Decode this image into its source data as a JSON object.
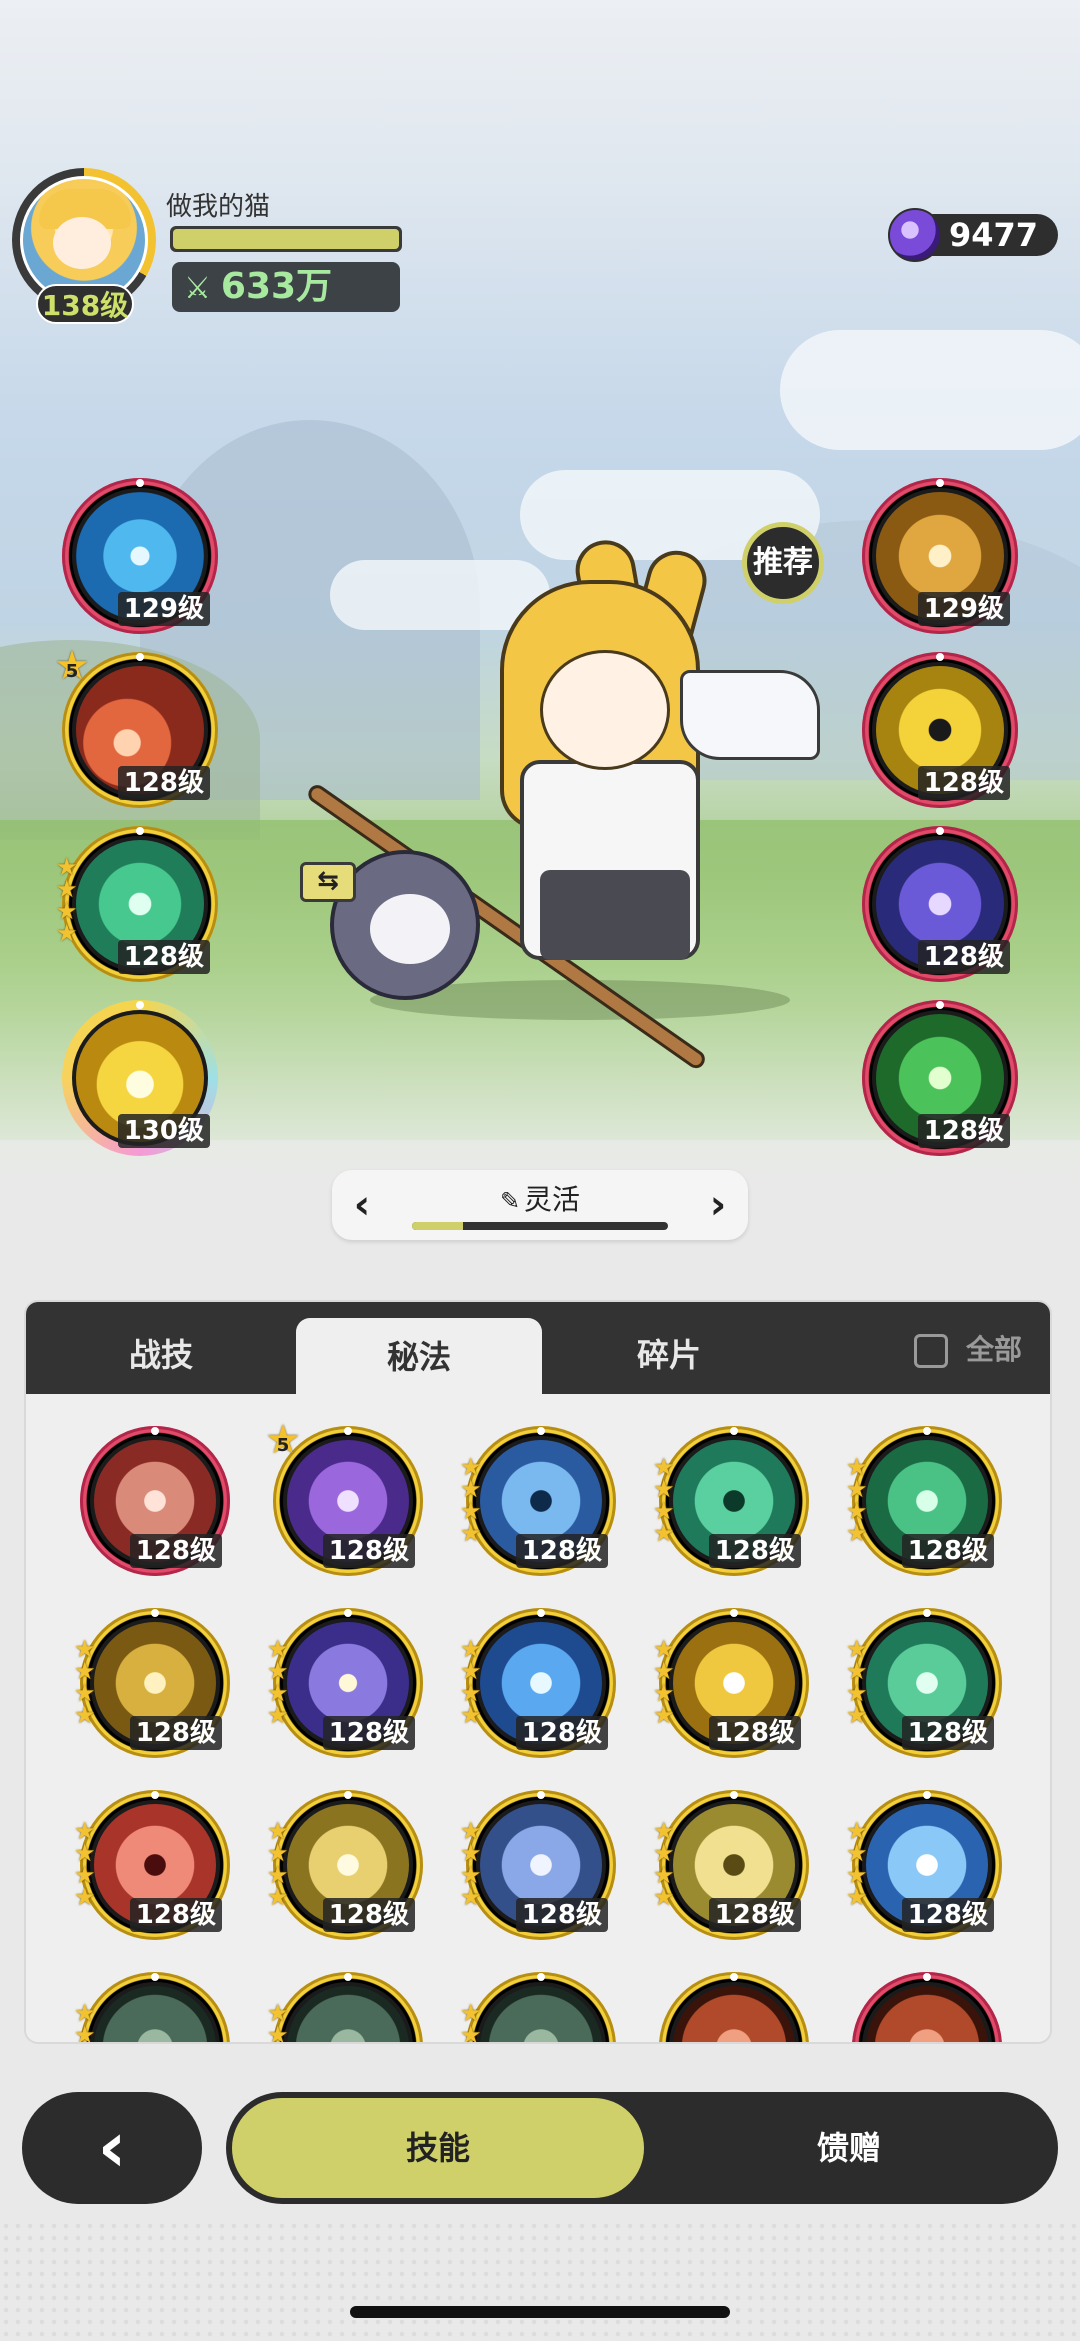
{
  "player": {
    "name": "做我的猫",
    "level": "138级",
    "power": "633万",
    "hp_fill_percent": 100
  },
  "currency": {
    "gems": "9477",
    "icon": "purple-gem-icon"
  },
  "equipped_left": [
    {
      "level": "129级",
      "ring": "red",
      "art": "swirl-blue",
      "stars": 0
    },
    {
      "level": "128级",
      "ring": "gold",
      "art": "fire",
      "stars": 5,
      "star_label": "5"
    },
    {
      "level": "128级",
      "ring": "gold",
      "art": "wind-green",
      "stars": 4
    },
    {
      "level": "130级",
      "ring": "rainbow",
      "art": "lightning",
      "stars": 0
    }
  ],
  "equipped_right": [
    {
      "level": "129级",
      "ring": "red",
      "art": "gold-slash"
    },
    {
      "level": "128级",
      "ring": "red",
      "art": "yellow-figure"
    },
    {
      "level": "128级",
      "ring": "red",
      "art": "purple-clock"
    },
    {
      "level": "128级",
      "ring": "red",
      "art": "green-blades"
    }
  ],
  "recommend_label": "推荐",
  "swap_icon": "swap-icon",
  "build": {
    "name": "灵活",
    "progress_percent": 20,
    "prev": "‹",
    "next": "›"
  },
  "tabs": {
    "t1": "战技",
    "t2": "秘法",
    "t3": "碎片",
    "all": "全部",
    "active": "秘法"
  },
  "grid": [
    {
      "level": "128级",
      "ring": "red",
      "art": "red-feather",
      "stars": 0
    },
    {
      "level": "128级",
      "ring": "gold",
      "art": "purple-rune",
      "stars": 5,
      "star_label": "5"
    },
    {
      "level": "128级",
      "ring": "gold",
      "art": "blue-figure",
      "stars": 4
    },
    {
      "level": "128级",
      "ring": "gold",
      "art": "teal-figure",
      "stars": 4
    },
    {
      "level": "128级",
      "ring": "gold",
      "art": "green-heart",
      "stars": 4
    },
    {
      "level": "128级",
      "ring": "gold",
      "art": "gold-hand",
      "stars": 4
    },
    {
      "level": "128级",
      "ring": "gold",
      "art": "purple-sparkle",
      "stars": 4
    },
    {
      "level": "128级",
      "ring": "gold",
      "art": "crystal",
      "stars": 4
    },
    {
      "level": "128级",
      "ring": "gold",
      "art": "gold-burst",
      "stars": 4
    },
    {
      "level": "128级",
      "ring": "gold",
      "art": "green-recycle",
      "stars": 4
    },
    {
      "level": "128级",
      "ring": "gold",
      "art": "red-figure",
      "stars": 4
    },
    {
      "level": "128级",
      "ring": "gold",
      "art": "gold-feather",
      "stars": 4
    },
    {
      "level": "128级",
      "ring": "gold",
      "art": "blue-star",
      "stars": 4
    },
    {
      "level": "128级",
      "ring": "gold",
      "art": "gold-figure",
      "stars": 4
    },
    {
      "level": "128级",
      "ring": "gold",
      "art": "ice",
      "stars": 4
    },
    {
      "level": "",
      "ring": "gold",
      "art": "dim",
      "stars": 4
    },
    {
      "level": "",
      "ring": "gold",
      "art": "dim",
      "stars": 4
    },
    {
      "level": "",
      "ring": "gold",
      "art": "dim",
      "stars": 4
    },
    {
      "level": "",
      "ring": "gold",
      "art": "dim-red",
      "stars": 0
    },
    {
      "level": "",
      "ring": "red",
      "art": "dim-red",
      "stars": 0
    }
  ],
  "bottom": {
    "back": "‹",
    "skills": "技能",
    "gift": "馈赠"
  }
}
